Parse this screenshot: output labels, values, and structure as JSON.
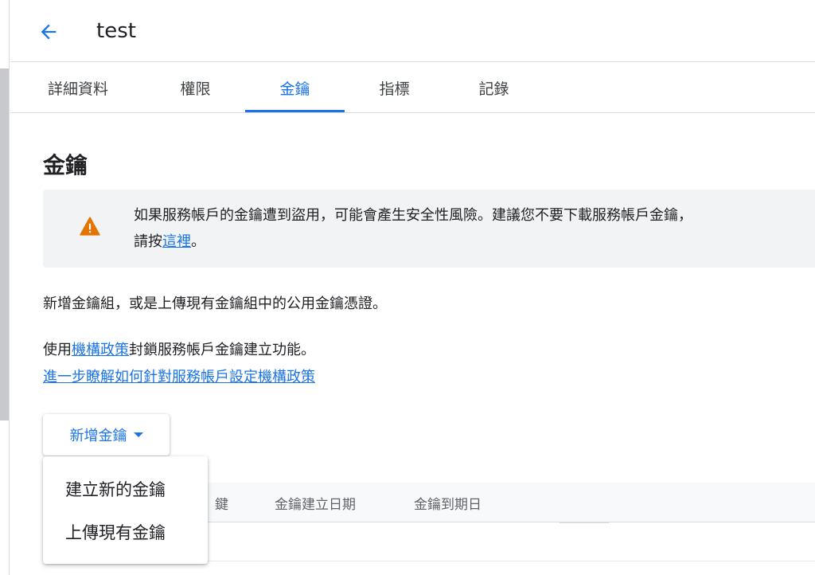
{
  "header": {
    "title": "test"
  },
  "tabs": [
    {
      "label": "詳細資料"
    },
    {
      "label": "權限"
    },
    {
      "label": "金鑰"
    },
    {
      "label": "指標"
    },
    {
      "label": "記錄"
    }
  ],
  "active_tab": "金鑰",
  "section": {
    "title": "金鑰"
  },
  "warning": {
    "line1": "如果服務帳戶的金鑰遭到盜用，可能會產生安全性風險。建議您不要下載服務帳戶金鑰，",
    "line2_prefix": "請按",
    "line2_link": "這裡",
    "line2_suffix": "。"
  },
  "description": {
    "line1": "新增金鑰組，或是上傳現有金鑰組中的公用金鑰憑證。",
    "line2_prefix": "使用",
    "line2_link": "機構政策",
    "line2_suffix": "封鎖服務帳戶金鑰建立功能。",
    "learn_more": "進一步瞭解如何針對服務帳戶設定機構政策"
  },
  "add_key_button": {
    "label": "新增金鑰"
  },
  "menu": {
    "items": [
      {
        "label": "建立新的金鑰"
      },
      {
        "label": "上傳現有金鑰"
      }
    ]
  },
  "table": {
    "columns": [
      "鍵",
      "金鑰建立日期",
      "金鑰到期日"
    ]
  },
  "colors": {
    "accent": "#1a73e8",
    "warning": "#e37400"
  }
}
